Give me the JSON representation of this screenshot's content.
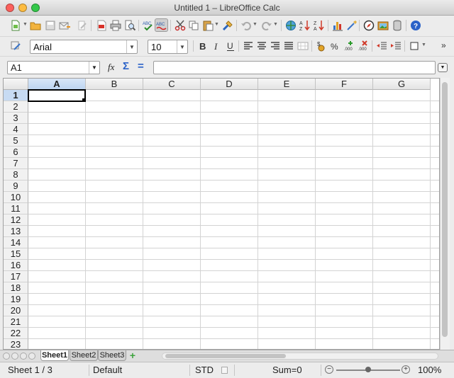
{
  "window": {
    "title": "Untitled 1 – LibreOffice Calc"
  },
  "font": {
    "name": "Arial",
    "size": "10"
  },
  "formula_bar": {
    "name_box": "A1",
    "function_wizard": "fx",
    "sum_symbol": "Σ",
    "equals_symbol": "=",
    "content": ""
  },
  "columns": [
    "A",
    "B",
    "C",
    "D",
    "E",
    "F",
    "G"
  ],
  "rows": [
    "1",
    "2",
    "3",
    "4",
    "5",
    "6",
    "7",
    "8",
    "9",
    "10",
    "11",
    "12",
    "13",
    "14",
    "15",
    "16",
    "17",
    "18",
    "19",
    "20",
    "21",
    "22",
    "23"
  ],
  "selected_cell": {
    "column": "A",
    "row": "1"
  },
  "sheets": [
    "Sheet1",
    "Sheet2",
    "Sheet3"
  ],
  "active_sheet": "Sheet1",
  "status": {
    "sheet": "Sheet 1 / 3",
    "page_style": "Default",
    "selection_mode": "STD",
    "sum": "Sum=0",
    "zoom": "100%",
    "zoom_percent": 100
  },
  "colors": {
    "selection_header": "#c7dbf3",
    "grid_line": "#d3d3d3",
    "close_light": "#fc605c",
    "minimize_light": "#fdbc40",
    "zoom_light": "#34c84a",
    "add_sheet": "#3da33d"
  },
  "toolbar": {
    "standard_icons": [
      "new-document-icon",
      "open-folder-icon",
      "save-icon",
      "email-icon",
      "edit-file-icon",
      "export-pdf-icon",
      "print-icon",
      "print-preview-icon",
      "spellcheck-icon",
      "autospellcheck-icon",
      "cut-icon",
      "copy-icon",
      "paste-icon",
      "clone-formatting-icon",
      "undo-icon",
      "redo-icon",
      "hyperlink-icon",
      "sort-ascending-icon",
      "sort-descending-icon",
      "chart-icon",
      "draw-functions-icon",
      "navigator-icon",
      "gallery-icon",
      "data-sources-icon",
      "help-icon"
    ],
    "formatting_icons": [
      "styles-icon",
      "bold-icon",
      "italic-icon",
      "underline-icon",
      "align-left-icon",
      "align-center-icon",
      "align-right-icon",
      "justify-icon",
      "merge-cells-icon",
      "currency-icon",
      "percent-icon",
      "add-decimal-icon",
      "delete-decimal-icon",
      "decrease-indent-icon",
      "increase-indent-icon",
      "borders-icon"
    ]
  }
}
